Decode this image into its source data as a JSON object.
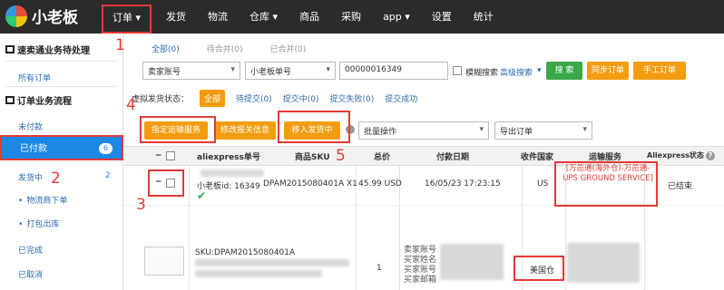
{
  "app": {
    "name": "小老板"
  },
  "nav": {
    "items": [
      "订单 ▾",
      "发货",
      "物流",
      "仓库 ▾",
      "商品",
      "采购",
      "app ▾",
      "设置",
      "统计"
    ]
  },
  "sidebar": {
    "section1": "速卖通业务待处理",
    "all_orders": "所有订单",
    "section2": "订单业务流程",
    "unpaid": "未付款",
    "paid": "已付款",
    "paid_count": "6",
    "shipping": "发货中",
    "shipping_count": "2",
    "logistics": "物流商下单",
    "pack": "打包出库",
    "done": "已完成",
    "cancelled": "已取消"
  },
  "tabs": {
    "all": "全部(0)",
    "pending_merge": "待合并(0)",
    "merged": "已合并(0)"
  },
  "filters": {
    "seller_account": "卖家账号",
    "order_no_type": "小老板单号",
    "search_value": "00000016349",
    "fuzzy": "模糊搜索",
    "advanced": "高级搜索",
    "search_btn": "搜 索",
    "sync_btn": "同步订单",
    "manual_btn": "手工订单"
  },
  "virtual_status": {
    "label": "虚拟发货状态：",
    "all": "全部",
    "pending": "待提交(0)",
    "submitting": "提交中(0)",
    "failed": "提交失败(0)",
    "success": "提交成功"
  },
  "actions": {
    "assign_shipping": "指定运输服务",
    "edit_customs": "修改报关信息",
    "move_shipping": "移入发货中",
    "batch": "批量操作",
    "export": "导出订单"
  },
  "columns": [
    "aliexpress单号",
    "商品SKU",
    "总价",
    "付款日期",
    "收件国家",
    "运输服务",
    "Aliexpress状态"
  ],
  "row1": {
    "xlb_id": "小老板id: 16349",
    "sku": "DPAM2015080401A X1",
    "total": "45.99 USD",
    "pay_date": "16/05/23 17:23:15",
    "country": "US",
    "shipping": "[万邑通(海外仓)-万邑通-UPS GROUND SERVICE]",
    "status": "已结束"
  },
  "row2": {
    "sku": "SKU:DPAM2015080401A",
    "qty": "1",
    "seller_lbl": "卖家账号",
    "buyer_name_lbl": "买家姓名",
    "buyer_acc_lbl": "买家账号",
    "buyer_email_lbl": "买家邮箱",
    "warehouse": "美国仓"
  },
  "annotations": [
    "1",
    "2",
    "3",
    "4",
    "5"
  ],
  "colors": {
    "accent_red": "#e53935",
    "blue": "#1e88e5",
    "orange": "#f39c12",
    "green": "#3aa849"
  }
}
